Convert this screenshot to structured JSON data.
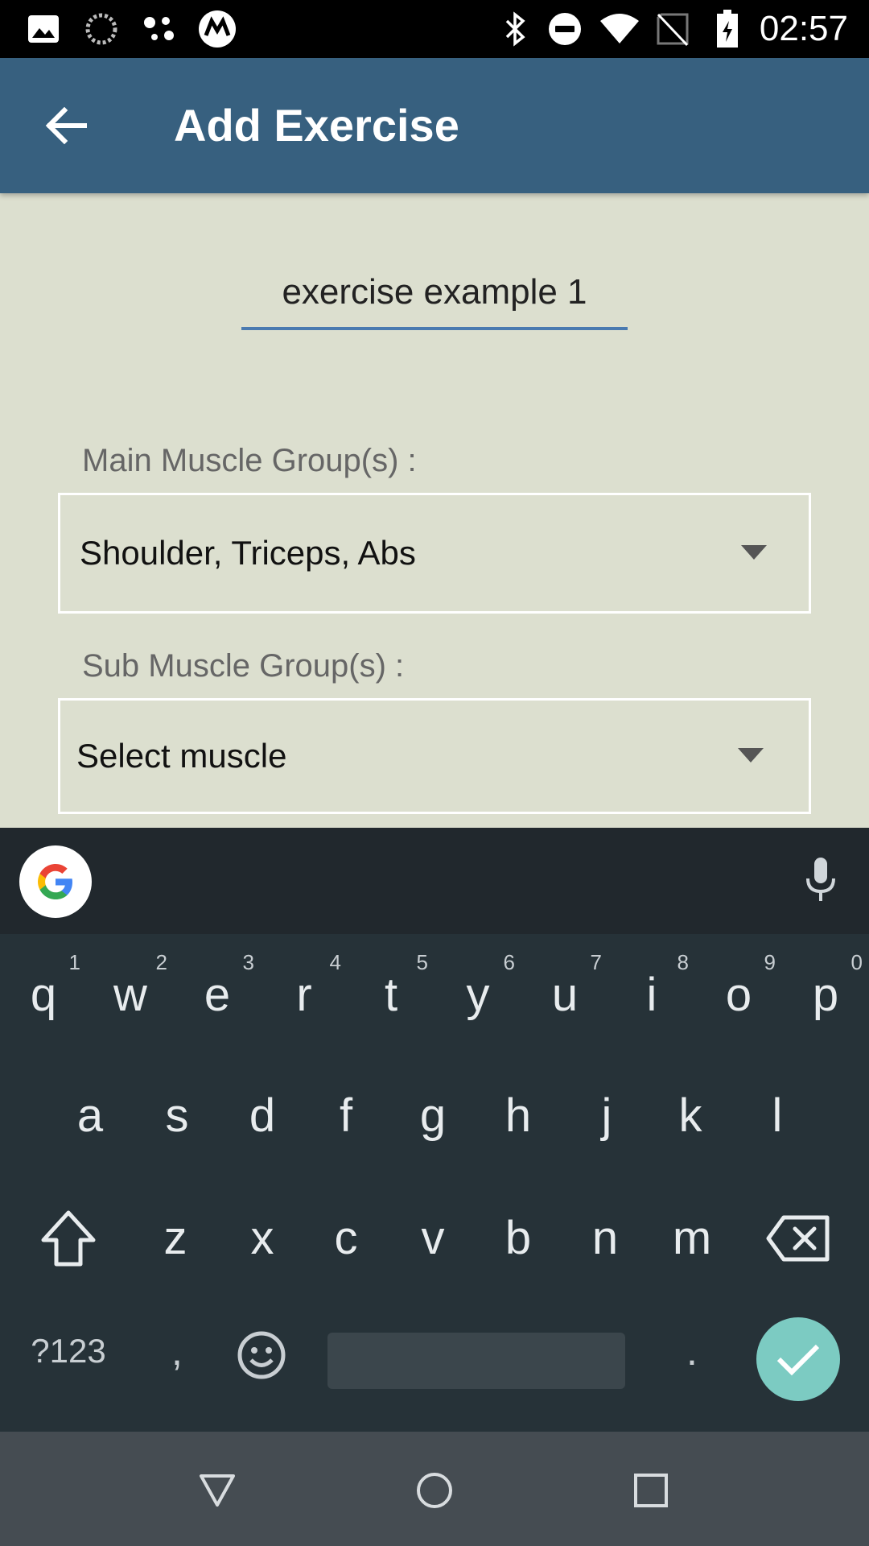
{
  "status_bar": {
    "time": "02:57",
    "left_icons": [
      "image-icon",
      "sync-icon",
      "assistant-dots-icon",
      "motorola-icon"
    ],
    "right_icons": [
      "bluetooth-icon",
      "do-not-disturb-icon",
      "wifi-icon",
      "no-sim-icon",
      "battery-charging-icon"
    ]
  },
  "app_bar": {
    "title": "Add Exercise",
    "back_icon": "arrow-back-icon",
    "color": "#37607f"
  },
  "form": {
    "exercise_name": "exercise example 1",
    "main_group_label": "Main Muscle Group(s) :",
    "main_group_value": "Shoulder, Triceps, Abs",
    "sub_group_label": "Sub Muscle Group(s) :",
    "sub_group_value": "Select muscle",
    "accent": "#4a7ab0",
    "background": "#dcdfcf"
  },
  "keyboard": {
    "row1": [
      {
        "k": "q",
        "h": "1"
      },
      {
        "k": "w",
        "h": "2"
      },
      {
        "k": "e",
        "h": "3"
      },
      {
        "k": "r",
        "h": "4"
      },
      {
        "k": "t",
        "h": "5"
      },
      {
        "k": "y",
        "h": "6"
      },
      {
        "k": "u",
        "h": "7"
      },
      {
        "k": "i",
        "h": "8"
      },
      {
        "k": "o",
        "h": "9"
      },
      {
        "k": "p",
        "h": "0"
      }
    ],
    "row2": [
      "a",
      "s",
      "d",
      "f",
      "g",
      "h",
      "j",
      "k",
      "l"
    ],
    "row3": [
      "z",
      "x",
      "c",
      "v",
      "b",
      "n",
      "m"
    ],
    "symbols_key": "?123",
    "comma_key": ",",
    "period_key": ".",
    "done_color": "#7ccbc2",
    "background": "#263238"
  },
  "nav_bar": {
    "icons": [
      "back-triangle-icon",
      "home-circle-icon",
      "recents-square-icon"
    ]
  }
}
